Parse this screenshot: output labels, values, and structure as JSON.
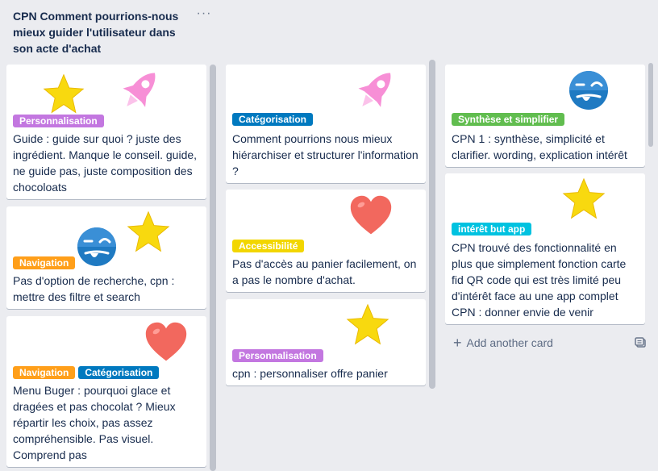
{
  "list": {
    "title": "CPN Comment pourrions-nous mieux guider l'utilisateur dans son acte d'achat",
    "menu_icon": "···"
  },
  "colors": {
    "personnalisation": "#c377e0",
    "navigation": "#ff9f1a",
    "categorisation": "#0079bf",
    "accessibilite": "#f2d600",
    "synthese": "#61bd4f",
    "interet": "#00c2e0"
  },
  "cards": {
    "c1": {
      "label": "Personnalisation",
      "text": "Guide : guide sur quoi ? juste des ingrédient. Manque le conseil. guide, ne guide pas, juste composition des chocoloats",
      "stickers": [
        "star-sticker",
        "rocket-sticker"
      ]
    },
    "c2": {
      "label": "Navigation",
      "text": "Pas d'option de recherche, cpn : mettre des filtre et search",
      "stickers": [
        "frown-face-sticker",
        "star-sticker"
      ]
    },
    "c3": {
      "label1": "Navigation",
      "label2": "Catégorisation",
      "text": "Menu Buger : pourquoi glace et dragées et pas chocolat ? Mieux répartir les choix, pas assez compréhensible. Pas visuel. Comprend pas",
      "stickers": [
        "heart-sticker"
      ]
    },
    "c4": {
      "label": "Catégorisation",
      "text": "Comment pourrions nous mieux hiérarchiser et structurer l'information ?",
      "stickers": [
        "rocket-sticker"
      ]
    },
    "c5": {
      "label": "Accessibilité",
      "text": "Pas d'accès au panier facilement, on a pas le nombre d'achat.",
      "stickers": [
        "heart-sticker"
      ]
    },
    "c6": {
      "label": "Personnalisation",
      "text": "cpn : personnaliser offre panier",
      "stickers": [
        "star-sticker"
      ]
    },
    "c7": {
      "label": "Synthèse et simplifier",
      "text": "CPN 1 : synthèse, simplicité et clarifier. wording, explication intérêt",
      "stickers": [
        "frown-face-sticker"
      ]
    },
    "c8": {
      "label": "intérêt but app",
      "text": "CPN trouvé des fonctionnalité en plus que simplement fonction carte fid QR code qui est très limité peu d'intérêt face au une app complet CPN : donner envie de venir régulièrement",
      "stickers": [
        "star-sticker"
      ]
    }
  },
  "add_card": {
    "label": "Add another card",
    "icon": "plus-icon"
  }
}
